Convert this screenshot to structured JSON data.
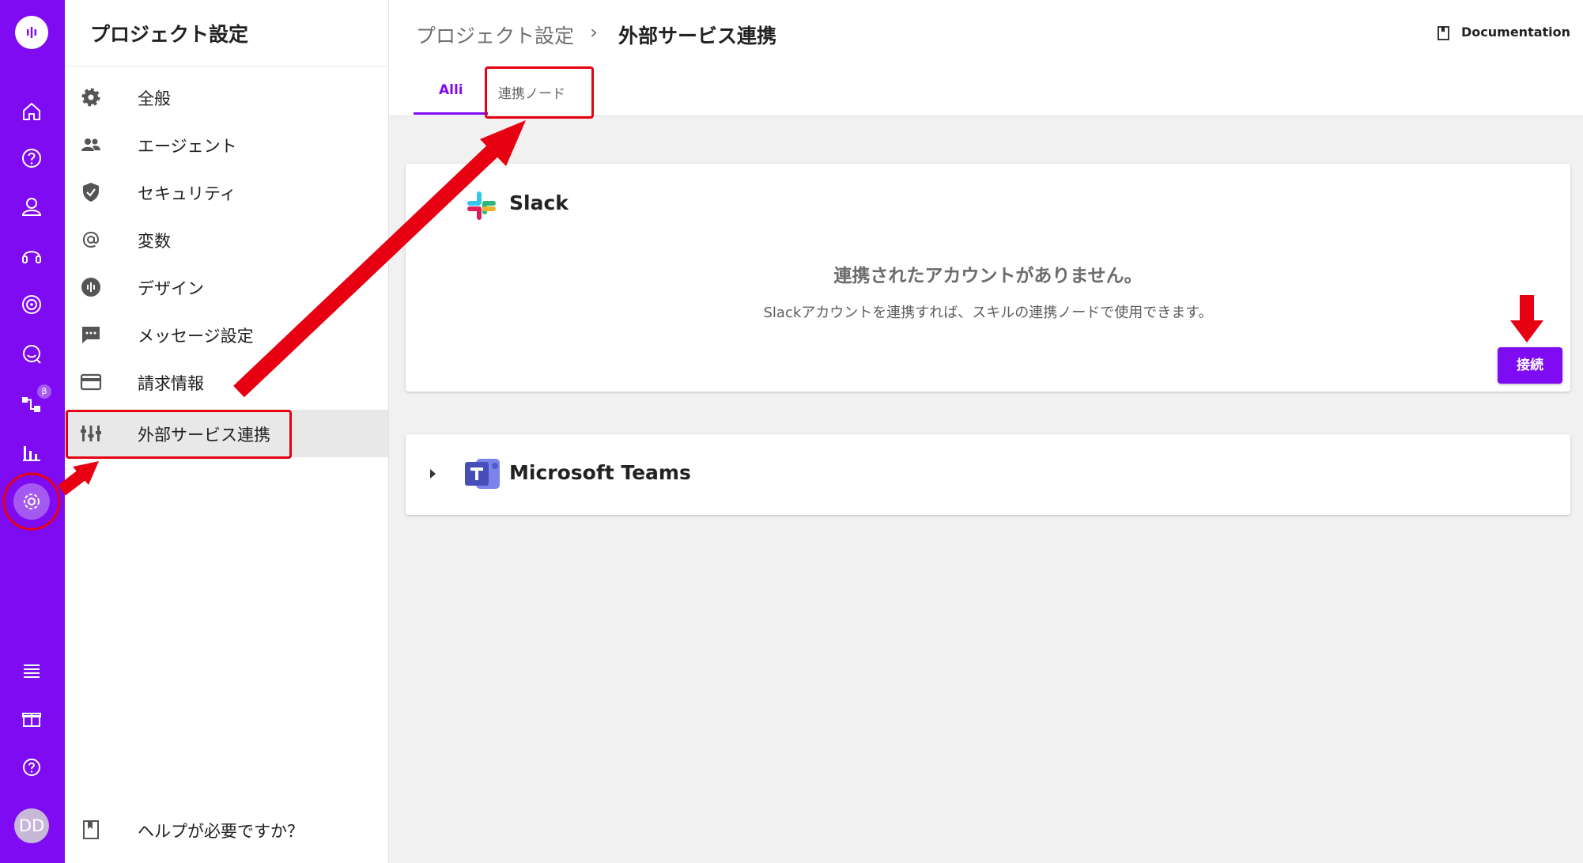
{
  "sidebar": {
    "title": "プロジェクト設定",
    "items": [
      {
        "label": "全般",
        "icon": "gear-icon"
      },
      {
        "label": "エージェント",
        "icon": "people-icon"
      },
      {
        "label": "セキュリティ",
        "icon": "shield-icon"
      },
      {
        "label": "変数",
        "icon": "at-icon"
      },
      {
        "label": "デザイン",
        "icon": "palette-icon"
      },
      {
        "label": "メッセージ設定",
        "icon": "message-icon"
      },
      {
        "label": "請求情報",
        "icon": "credit-card-icon"
      },
      {
        "label": "外部サービス連携",
        "icon": "integration-icon",
        "active": true
      }
    ],
    "help_label": "ヘルプが必要ですか？"
  },
  "rail": {
    "avatar_initials": "DD",
    "beta_badge": "β",
    "accent": "#7f0bf2"
  },
  "header": {
    "breadcrumb_parent": "プロジェクト設定",
    "breadcrumb_sep": "›",
    "breadcrumb_current": "外部サービス連携",
    "documentation_label": "Documentation"
  },
  "tabs": [
    {
      "label": "Alli",
      "active": true
    },
    {
      "label": "連携ノード",
      "active": false
    }
  ],
  "integrations": {
    "slack": {
      "name": "Slack",
      "empty_title": "連携されたアカウントがありません。",
      "empty_desc": "Slackアカウントを連携すれば、スキルの連携ノードで使用できます。",
      "connect_label": "接続"
    },
    "teams": {
      "name": "Microsoft Teams"
    }
  },
  "annotation_color": "#e60012"
}
